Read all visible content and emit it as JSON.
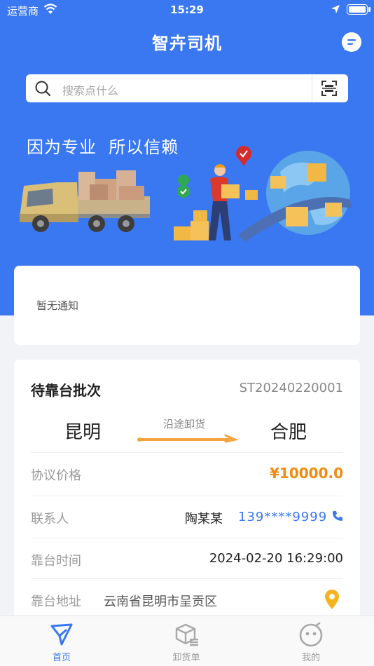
{
  "status_bar": {
    "carrier": "运营商",
    "time": "15:29"
  },
  "header": {
    "title": "智卉司机"
  },
  "search": {
    "placeholder": "搜索点什么"
  },
  "banner": {
    "slogan": "因为专业  所以信赖"
  },
  "notice": {
    "text": "暂无通知"
  },
  "batch": {
    "title": "待靠台批次",
    "code": "ST20240220001",
    "route": {
      "from": "昆明",
      "to": "合肥",
      "via": "沿途卸货"
    },
    "price_label": "协议价格",
    "price_value": "¥10000.0",
    "contact_label": "联系人",
    "contact_name": "陶某某",
    "contact_phone": "139****9999",
    "time_label": "靠台时间",
    "time_value": "2024-02-20 16:29:00",
    "address_label": "靠台地址",
    "address_value": "云南省昆明市呈贡区"
  },
  "tabbar": {
    "tabs": [
      {
        "label": "首页"
      },
      {
        "label": "卸货单"
      },
      {
        "label": "我的"
      }
    ]
  },
  "colors": {
    "primary": "#3a78f2",
    "accent": "#f08a10",
    "pin": "#f5b21d"
  }
}
